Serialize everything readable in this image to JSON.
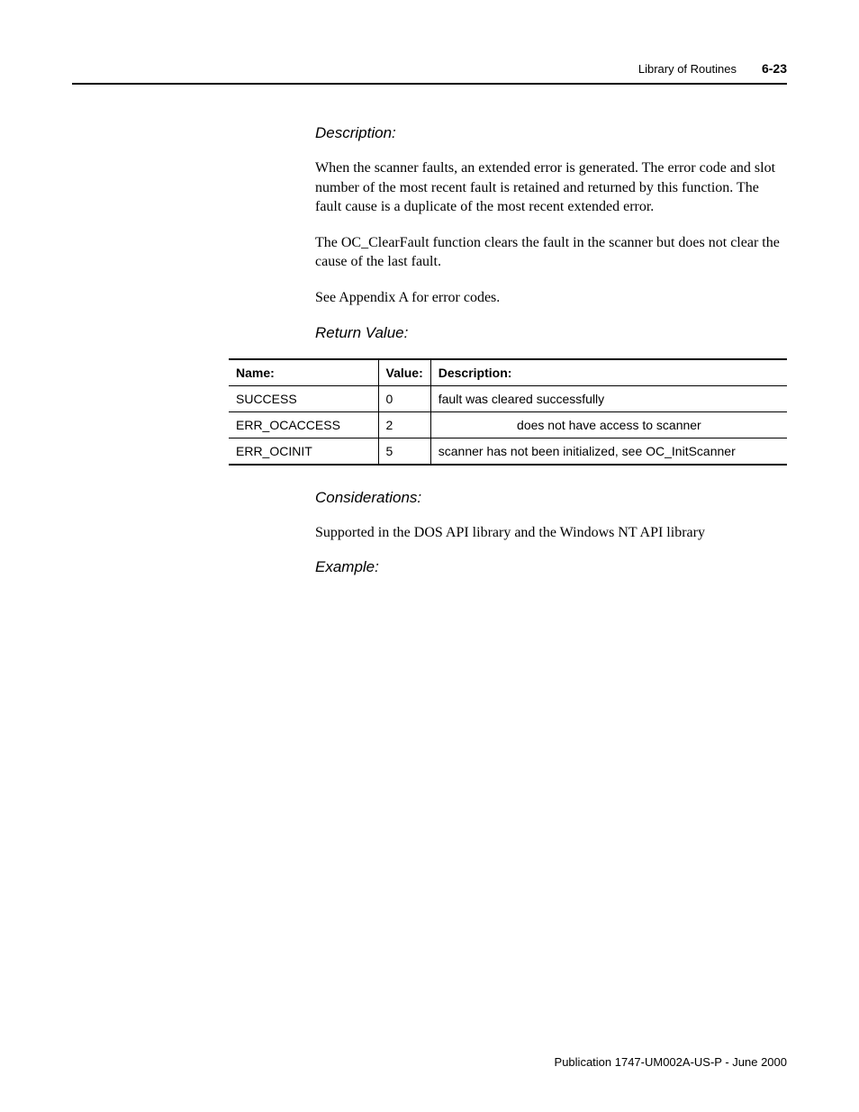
{
  "header": {
    "title": "Library of Routines",
    "page": "6-23"
  },
  "sections": {
    "description": {
      "heading": "Description:",
      "p1": "When the scanner faults, an extended error is generated. The error code and slot number of the most recent fault is retained and returned by this function. The fault cause is a duplicate of the most recent extended error.",
      "p2": "The OC_ClearFault function clears the fault in the scanner but does not clear the cause of the last fault.",
      "p3": "See Appendix A for error codes."
    },
    "returnValue": {
      "heading": "Return Value:",
      "cols": {
        "name": "Name:",
        "value": "Value:",
        "description": "Description:"
      },
      "rows": [
        {
          "name": "SUCCESS",
          "value": "0",
          "description": "fault was cleared successfully",
          "center": false
        },
        {
          "name": "ERR_OCACCESS",
          "value": "2",
          "description": "does not have access to scanner",
          "center": true
        },
        {
          "name": "ERR_OCINIT",
          "value": "5",
          "description": "scanner has not been initialized, see OC_InitScanner",
          "center": false
        }
      ]
    },
    "considerations": {
      "heading": "Considerations:",
      "p1": "Supported in the DOS API library and the Windows NT API library"
    },
    "example": {
      "heading": "Example:"
    }
  },
  "footer": {
    "text": "Publication 1747-UM002A-US-P - June 2000"
  }
}
